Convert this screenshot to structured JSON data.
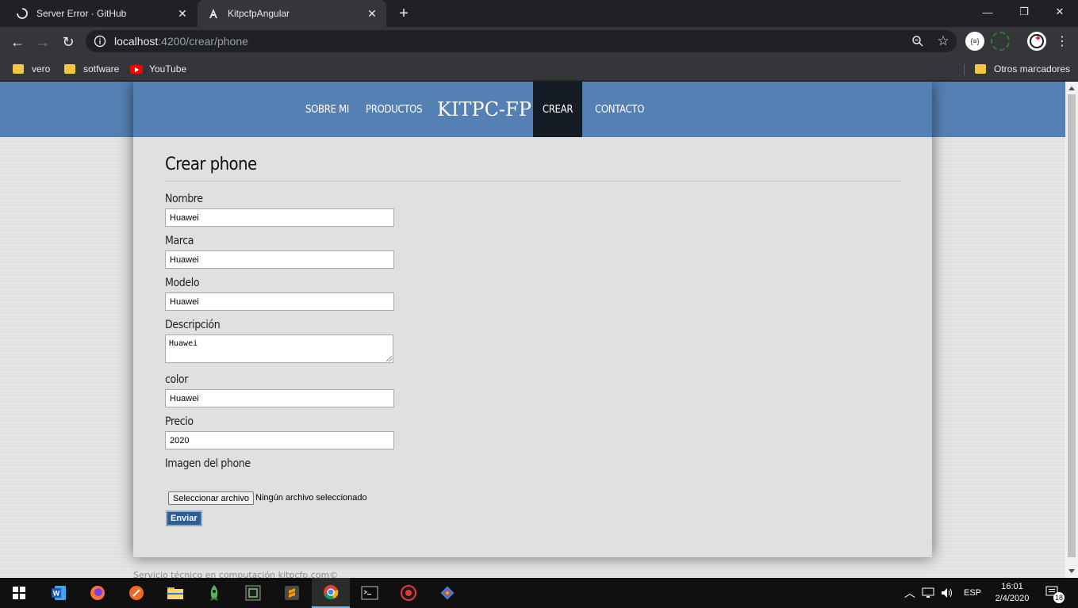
{
  "browser": {
    "tabs": [
      {
        "title": "Server Error · GitHub",
        "active": false
      },
      {
        "title": "KitpcfpAngular",
        "active": true
      }
    ],
    "url_host": "localhost",
    "url_path": ":4200/crear/phone",
    "bookmarks": [
      {
        "label": "vero",
        "icon": "folder-icon"
      },
      {
        "label": "sotfware",
        "icon": "folder-icon"
      },
      {
        "label": "YouTube",
        "icon": "youtube-icon"
      }
    ],
    "other_bookmarks": "Otros marcadores",
    "extension_label": "{≡}"
  },
  "site": {
    "nav": [
      "SOBRE MI",
      "PRODUCTOS",
      "CREAR",
      "CONTACTO"
    ],
    "brand": "KITPC-FP",
    "active_nav": "CREAR"
  },
  "form": {
    "title": "Crear phone",
    "fields": {
      "nombre": {
        "label": "Nombre",
        "value": "Huawei"
      },
      "marca": {
        "label": "Marca",
        "value": "Huawei"
      },
      "modelo": {
        "label": "Modelo",
        "value": "Huawei"
      },
      "descripcion": {
        "label": "Descripción",
        "value": "Huawei"
      },
      "color": {
        "label": "color",
        "value": "Huawei"
      },
      "precio": {
        "label": "Precio",
        "value": "2020"
      }
    },
    "image_label": "Imagen del phone",
    "file_button": "Seleccionar archivo",
    "file_status": "Ningún archivo seleccionado",
    "submit": "Enviar"
  },
  "footer": "Servicio técnico en computación kitpcfp.com©",
  "taskbar": {
    "language": "ESP",
    "time": "16:01",
    "date": "2/4/2020",
    "notifications": "18"
  },
  "colors": {
    "header_blue": "#5580b3",
    "nav_active": "#151c26",
    "submit_blue": "#2c5d96"
  }
}
